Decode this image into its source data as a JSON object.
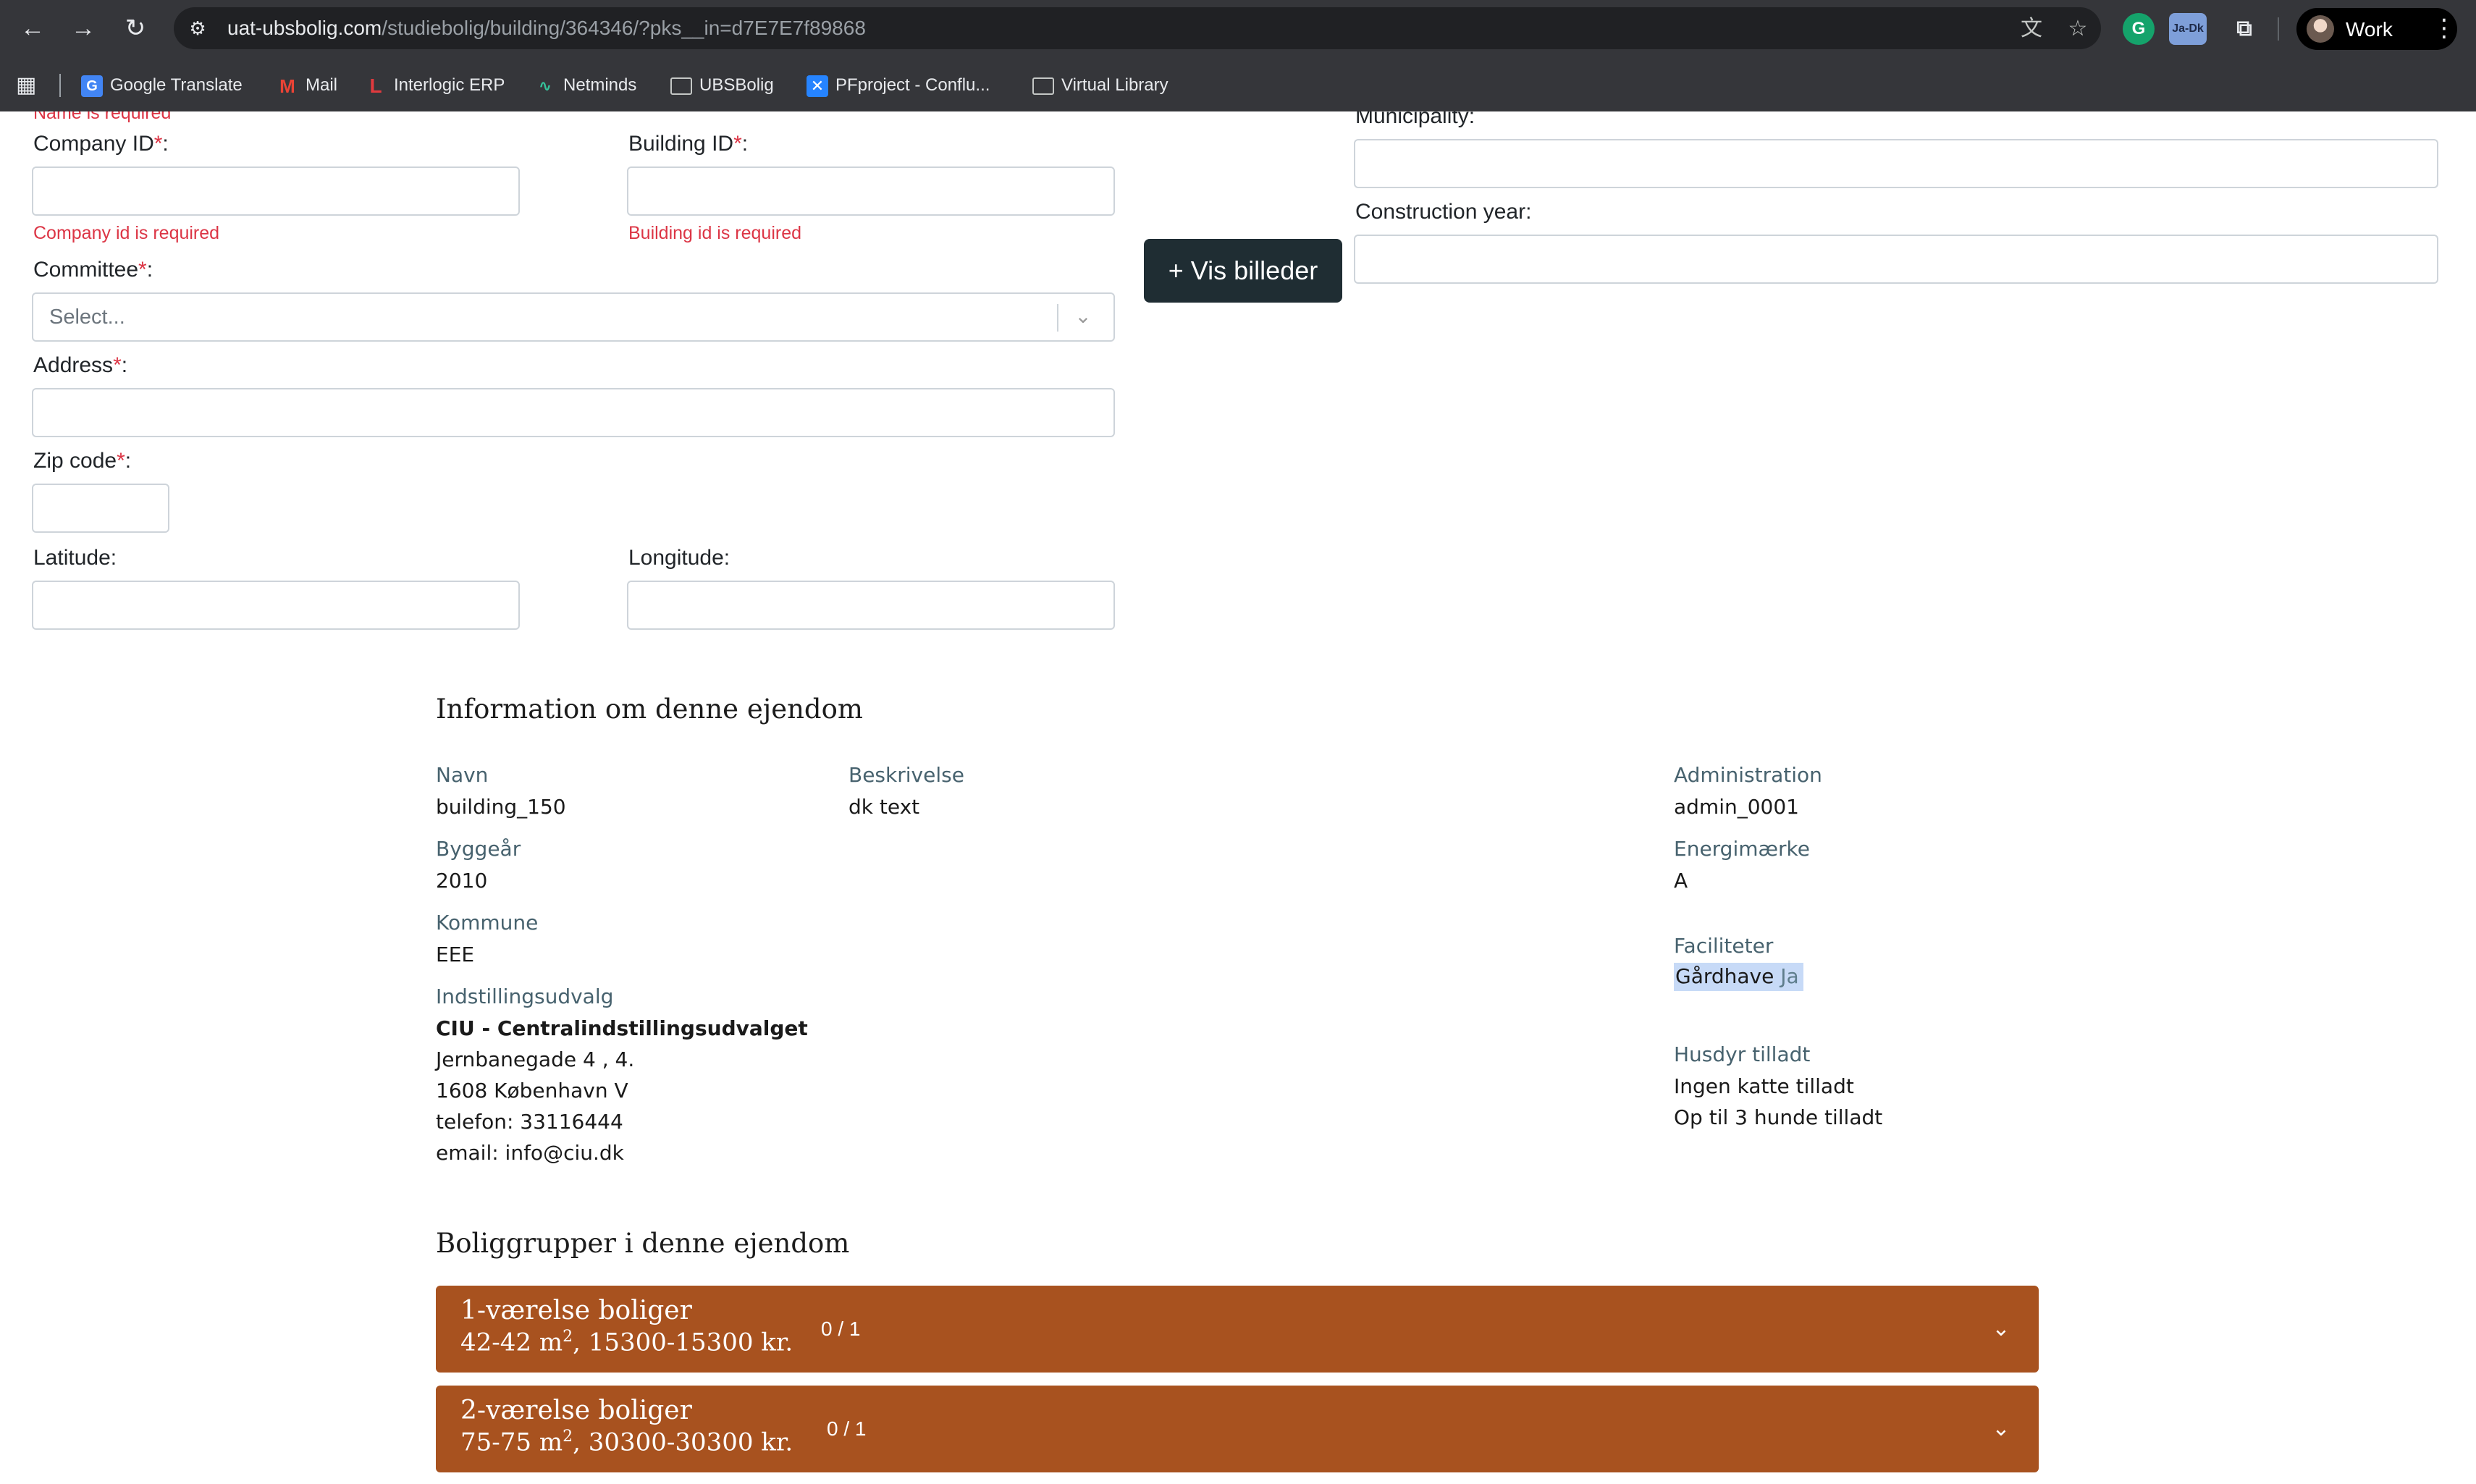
{
  "browser": {
    "url_host": "uat-ubsbolig.com",
    "url_path": "/studiebolig/building/364346/?pks__in=d7E7E7f89868",
    "profile_name": "Work",
    "extension_badge": "Ja-Dk",
    "bookmarks": [
      {
        "label": "Google Translate",
        "icon": "google-translate-icon"
      },
      {
        "label": "Mail",
        "icon": "gmail-icon"
      },
      {
        "label": "Interlogic ERP",
        "icon": "interlogic-icon"
      },
      {
        "label": "Netminds",
        "icon": "netminds-icon"
      },
      {
        "label": "UBSBolig",
        "icon": "folder-icon"
      },
      {
        "label": "PFproject - Conflu...",
        "icon": "confluence-icon"
      },
      {
        "label": "Virtual Library",
        "icon": "folder-icon"
      }
    ]
  },
  "form": {
    "name_error": "Name is required",
    "company_id": {
      "label": "Company ID",
      "value": "",
      "error": "Company id is required"
    },
    "building_id": {
      "label": "Building ID",
      "value": "",
      "error": "Building id is required"
    },
    "committee": {
      "label": "Committee",
      "placeholder": "Select..."
    },
    "address": {
      "label": "Address",
      "value": ""
    },
    "zip_code": {
      "label": "Zip code",
      "value": ""
    },
    "latitude": {
      "label": "Latitude:",
      "value": ""
    },
    "longitude": {
      "label": "Longitude:",
      "value": ""
    },
    "municipality": {
      "label": "Municipality:",
      "value": ""
    },
    "construction_year": {
      "label": "Construction year:",
      "value": ""
    },
    "required_mark": "*",
    "colon": ":",
    "vis_billeder": "+ Vis billeder"
  },
  "info": {
    "title": "Information om denne ejendom",
    "navn": {
      "label": "Navn",
      "value": "building_150"
    },
    "beskrivelse": {
      "label": "Beskrivelse",
      "value": "dk text"
    },
    "administration": {
      "label": "Administration",
      "value": "admin_0001"
    },
    "byggeaar": {
      "label": "Byggeår",
      "value": "2010"
    },
    "energimaerke": {
      "label": "Energimærke",
      "value": "A"
    },
    "kommune": {
      "label": "Kommune",
      "value": "EEE"
    },
    "faciliteter": {
      "label": "Faciliteter",
      "name": "Gårdhave",
      "value": "Ja"
    },
    "indstillingsudvalg": {
      "label": "Indstillingsudvalg",
      "name": "CIU - Centralindstillingsudvalget",
      "street": "Jernbanegade 4 , 4.",
      "city": "1608 København V",
      "phone": "telefon: 33116444",
      "email": "email: info@ciu.dk"
    },
    "husdyr": {
      "label": "Husdyr tilladt",
      "lines": [
        "Ingen katte tilladt",
        "Op til 3 hunde tilladt"
      ]
    }
  },
  "groups": {
    "title": "Boliggrupper i denne ejendom",
    "items": [
      {
        "title": "1-værelse boliger",
        "area": "42-42 m",
        "price": ", 15300-15300 kr.",
        "count": "0 / 1"
      },
      {
        "title": "2-værelse boliger",
        "area": "75-75 m",
        "price": ", 30300-30300 kr.",
        "count": "0 / 1"
      }
    ],
    "sup": "2"
  },
  "colors": {
    "accent": "#a8521f",
    "error": "#dc3545",
    "label": "#47626e",
    "button": "#1f2d33"
  }
}
